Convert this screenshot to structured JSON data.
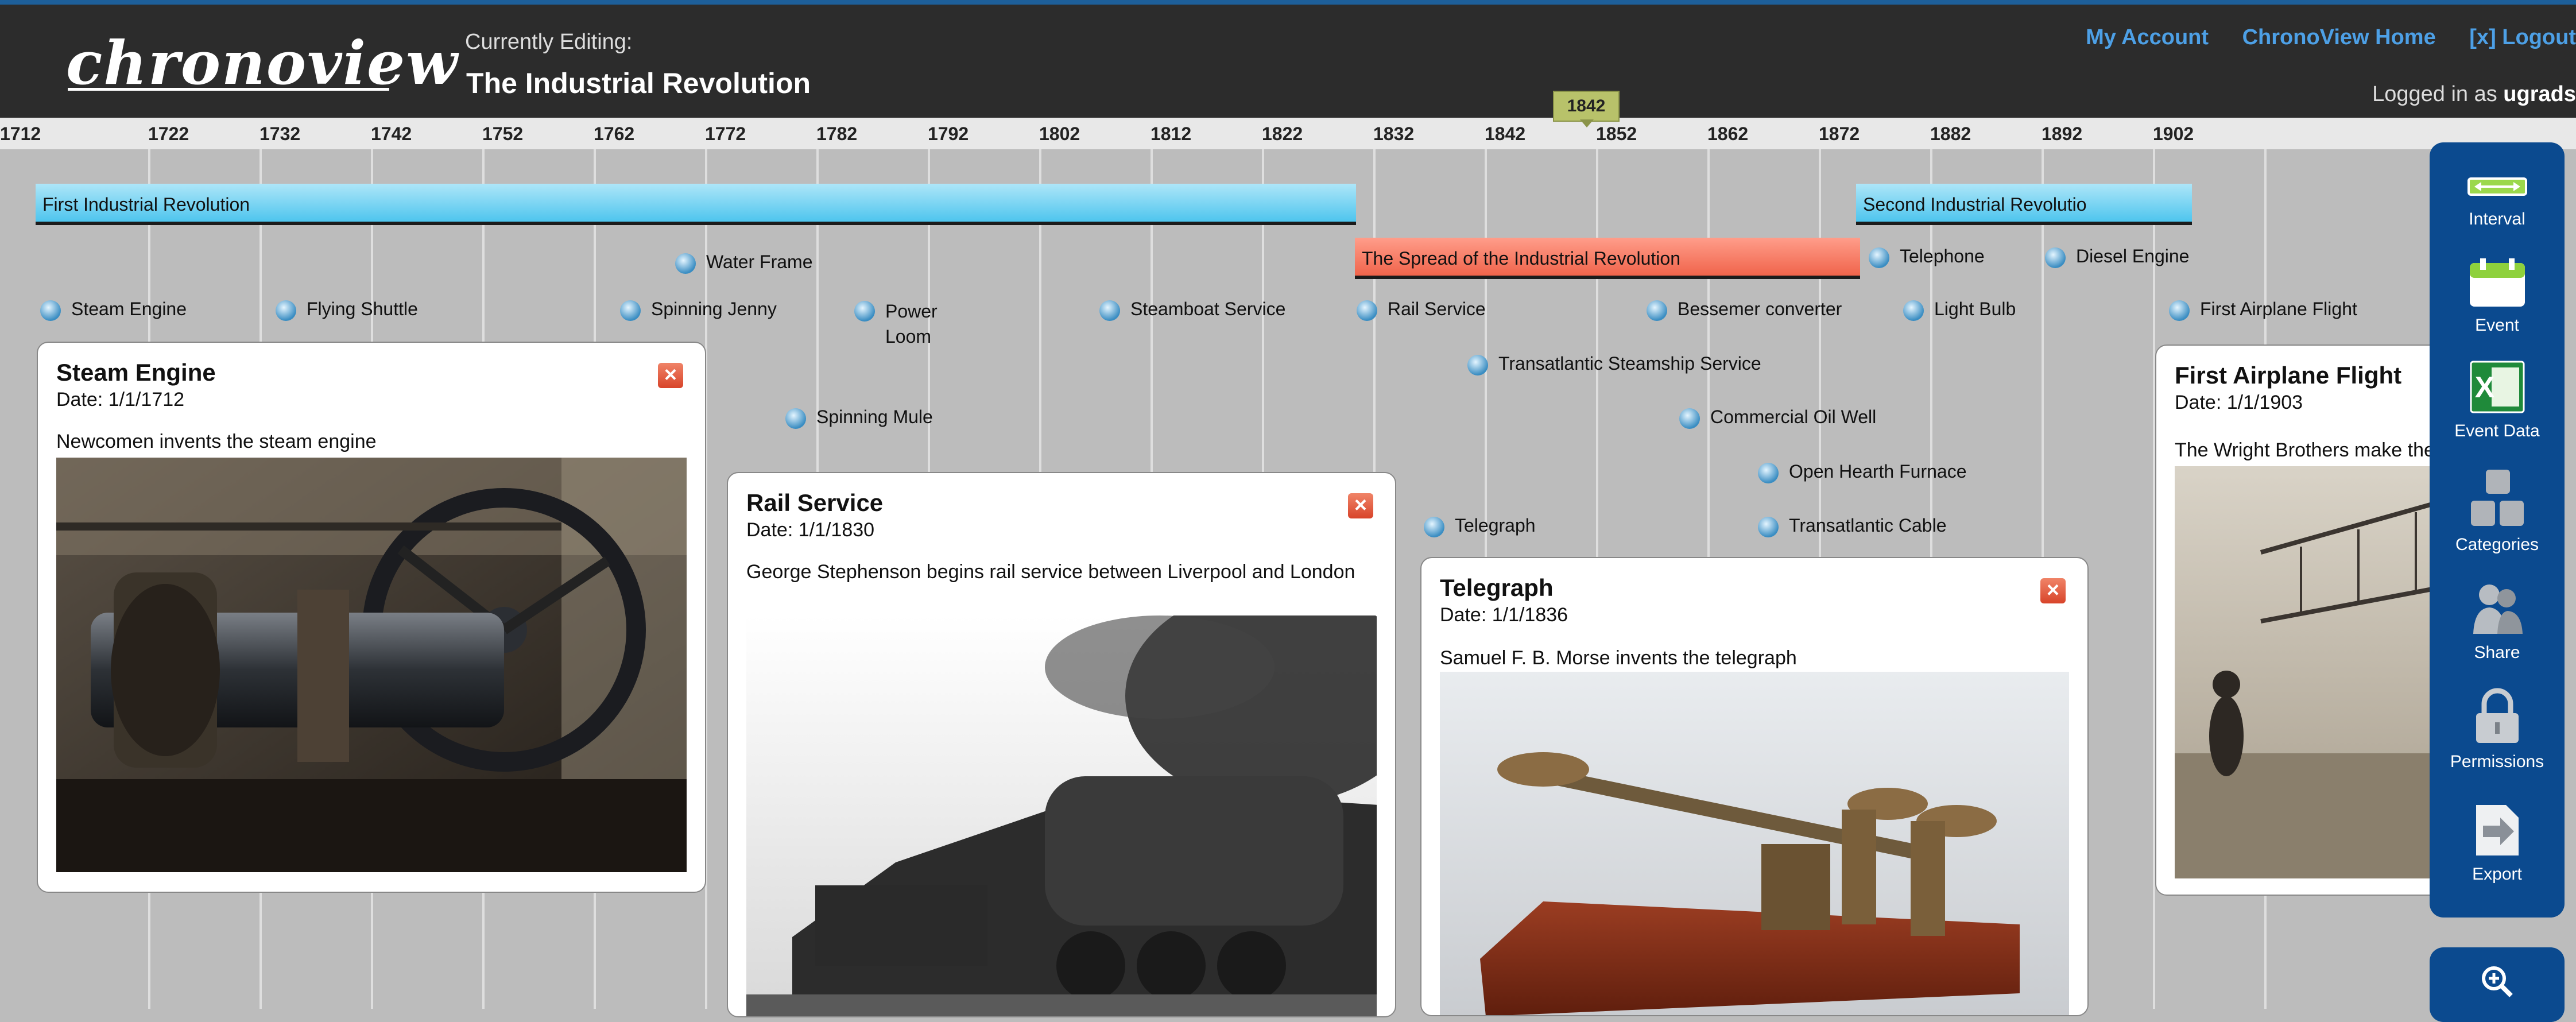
{
  "app": {
    "logo": "chronoview",
    "editing_label": "Currently Editing:",
    "editing_title": "The Industrial Revolution",
    "nav": {
      "my_account": "My Account",
      "home": "ChronoView Home",
      "logout": "[x] Logout"
    },
    "logged_in_prefix": "Logged in as",
    "logged_in_user": "ugrads"
  },
  "timeline": {
    "ticks": [
      "1712",
      "1722",
      "1732",
      "1742",
      "1752",
      "1762",
      "1772",
      "1782",
      "1792",
      "1802",
      "1812",
      "1822",
      "1832",
      "1842",
      "1852",
      "1862",
      "1872",
      "1882",
      "1892",
      "1902"
    ],
    "current_marker": "1842",
    "intervals": [
      {
        "label": "First Industrial Revolution",
        "color": "#4ec5ee"
      },
      {
        "label": "The Spread of the Industrial Revolution",
        "color": "#f0644b"
      },
      {
        "label": "Second Industrial Revolutio",
        "color": "#4ec5ee"
      }
    ],
    "events": [
      "Steam Engine",
      "Flying Shuttle",
      "Water Frame",
      "Spinning Jenny",
      "Power\nLoom",
      "Spinning Mule",
      "Steamboat Service",
      "Rail Service",
      "Telegraph",
      "Transatlantic Steamship Service",
      "Bessemer converter",
      "Commercial Oil Well",
      "Open Hearth Furnace",
      "Transatlantic Cable",
      "Telephone",
      "Light Bulb",
      "Diesel Engine",
      "First Airplane Flight"
    ]
  },
  "popups": [
    {
      "title": "Steam Engine",
      "date": "Date: 1/1/1712",
      "desc": "Newcomen invents the steam engine",
      "close": "×"
    },
    {
      "title": "Rail Service",
      "date": "Date: 1/1/1830",
      "desc": "George Stephenson begins rail service between Liverpool and London",
      "close": "×"
    },
    {
      "title": "Telegraph",
      "date": "Date: 1/1/1836",
      "desc": "Samuel F. B. Morse invents the telegraph",
      "close": "×"
    },
    {
      "title": "First Airplane Flight",
      "date": "Date: 1/1/1903",
      "desc": "The Wright Brothers make the",
      "close": "×"
    }
  ],
  "toolbar": {
    "interval": "Interval",
    "event": "Event",
    "event_data": "Event Data",
    "categories": "Categories",
    "share": "Share",
    "permissions": "Permissions",
    "export": "Export"
  },
  "icons": [
    "interval-icon",
    "event-icon",
    "excel-icon",
    "categories-icon",
    "share-icon",
    "lock-icon",
    "export-icon",
    "zoom-in-icon",
    "close-icon",
    "event-dot-icon"
  ],
  "colors": {
    "header": "#2c2c2c",
    "accent_blue": "#1d5f9a",
    "nav_link": "#4da0e6",
    "sidebar": "#0b4a8f",
    "interval_blue": "#4ec5ee",
    "interval_red": "#f0644b",
    "marker": "#b8c26a"
  }
}
